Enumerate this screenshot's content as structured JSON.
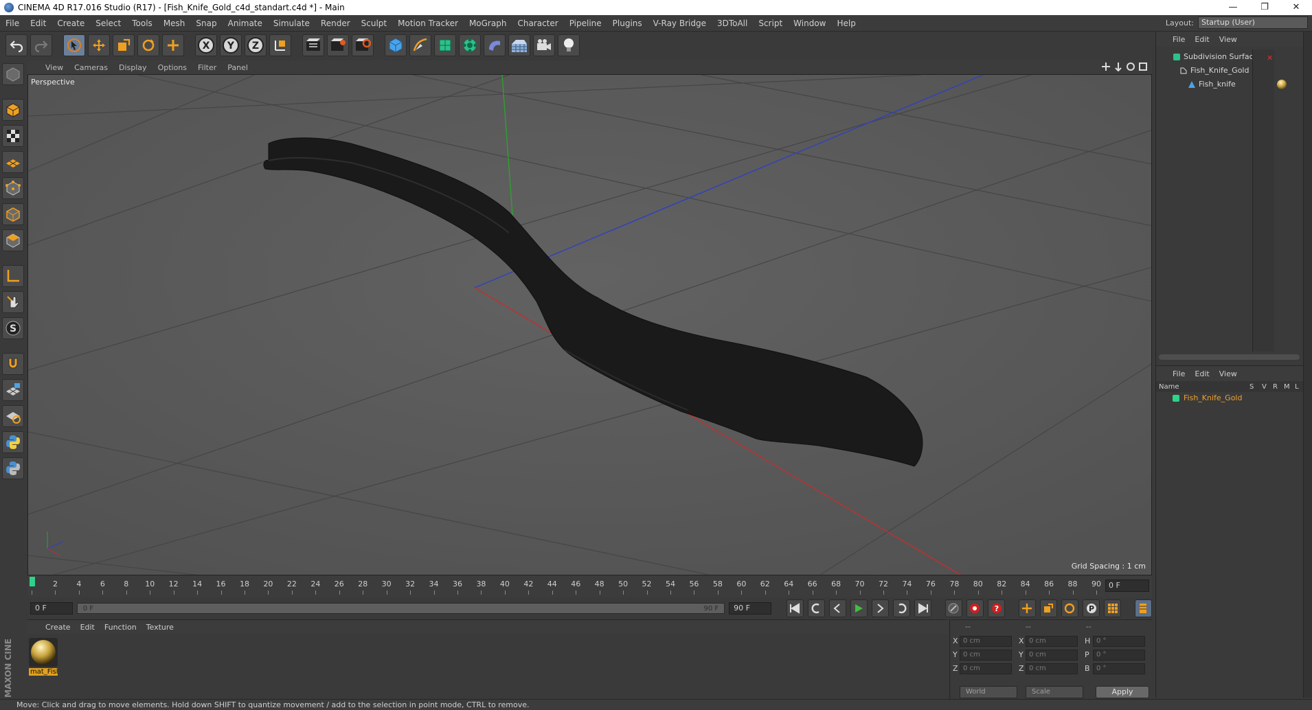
{
  "window": {
    "title": "CINEMA 4D R17.016 Studio (R17) - [Fish_Knife_Gold_c4d_standart.c4d *] - Main",
    "minimize": "—",
    "restore": "❐",
    "close": "✕"
  },
  "menubar": {
    "items": [
      "File",
      "Edit",
      "Create",
      "Select",
      "Tools",
      "Mesh",
      "Snap",
      "Animate",
      "Simulate",
      "Render",
      "Sculpt",
      "Motion Tracker",
      "MoGraph",
      "Character",
      "Pipeline",
      "Plugins",
      "V-Ray Bridge",
      "3DToAll",
      "Script",
      "Window",
      "Help"
    ],
    "layout_label": "Layout:",
    "layout_value": "Startup (User)"
  },
  "toolbar": {
    "icons": [
      "undo-icon",
      "redo-icon",
      "select-icon",
      "move-icon",
      "scale-icon",
      "rotate-icon",
      "transform-icon",
      "x-axis-icon",
      "y-axis-icon",
      "z-axis-icon",
      "world-coord-icon",
      "render-view-icon",
      "render-picture-queue-icon",
      "render-settings-icon",
      "cube-icon",
      "pen-icon",
      "subdivide-icon",
      "cloner-icon",
      "deformer-icon",
      "floor-icon",
      "camera-icon",
      "light-icon"
    ],
    "axis_labels": [
      "X",
      "Y",
      "Z"
    ]
  },
  "left_toolbar": {
    "icons": [
      "make-editable-icon",
      "model-mode-icon",
      "texture-mode-icon",
      "workplane-icon",
      "points-mode-icon",
      "edges-mode-icon",
      "polygons-mode-icon",
      "axis-mode-icon",
      "tweak-icon",
      "snap-icon",
      "magnet-icon",
      "lock-grid-icon",
      "deform-icon",
      "python-icon",
      "python-script-icon"
    ],
    "snap_letter": "S",
    "logo_text": "MAXON CINEMA 4D"
  },
  "viewport": {
    "menu": [
      "View",
      "Cameras",
      "Display",
      "Options",
      "Filter",
      "Panel"
    ],
    "camera": "Perspective",
    "grid_spacing": "Grid Spacing : 1 cm",
    "background": "#5b5b5b",
    "object_color": "#1a1a1a",
    "axis_colors": {
      "x": "#c03030",
      "y": "#30a030",
      "z": "#3040c0"
    }
  },
  "timeline": {
    "ticks": [
      0,
      2,
      4,
      6,
      8,
      10,
      12,
      14,
      16,
      18,
      20,
      22,
      24,
      26,
      28,
      30,
      32,
      34,
      36,
      38,
      40,
      42,
      44,
      46,
      48,
      50,
      52,
      54,
      56,
      58,
      60,
      62,
      64,
      66,
      68,
      70,
      72,
      74,
      76,
      78,
      80,
      82,
      84,
      86,
      88,
      90
    ],
    "current_frame": "0 F",
    "start_frame": "0 F",
    "range_start": "0 F",
    "range_end": "90 F",
    "end_frame": "90 F"
  },
  "transport": {
    "icons": [
      "goto-start-icon",
      "prev-key-icon",
      "step-back-icon",
      "play-icon",
      "step-forward-icon",
      "next-key-icon",
      "goto-end-icon",
      "record-icon",
      "autokey-icon",
      "keyframe-selection-icon",
      "move-key-icon",
      "scale-key-icon",
      "rotate-key-icon",
      "param-key-icon",
      "pla-key-icon",
      "timeline-icon"
    ]
  },
  "material_manager": {
    "menu": [
      "Create",
      "Edit",
      "Function",
      "Texture"
    ],
    "materials": [
      {
        "name": "mat_Fish"
      }
    ]
  },
  "coordinates": {
    "headers": [
      "--",
      "--",
      "--"
    ],
    "rows": [
      {
        "a": "X",
        "av": "0 cm",
        "b": "X",
        "bv": "0 cm",
        "c": "H",
        "cv": "0 °"
      },
      {
        "a": "Y",
        "av": "0 cm",
        "b": "Y",
        "bv": "0 cm",
        "c": "P",
        "cv": "0 °"
      },
      {
        "a": "Z",
        "av": "0 cm",
        "b": "Z",
        "bv": "0 cm",
        "c": "B",
        "cv": "0 °"
      }
    ],
    "mode": "World",
    "size_mode": "Scale",
    "apply": "Apply"
  },
  "object_manager": {
    "menu": [
      "File",
      "Edit",
      "View"
    ],
    "objects": [
      {
        "name": "Subdivision Surface",
        "depth": 0
      },
      {
        "name": "Fish_Knife_Gold",
        "depth": 1
      },
      {
        "name": "Fish_knife",
        "depth": 2
      }
    ]
  },
  "layer_manager": {
    "menu": [
      "File",
      "Edit",
      "View"
    ],
    "columns": {
      "name": "Name",
      "s": "S",
      "v": "V",
      "r": "R",
      "m": "M",
      "l": "L"
    },
    "layers": [
      {
        "name": "Fish_Knife_Gold",
        "color": "#2ed38a"
      }
    ]
  },
  "status": {
    "text": "Move: Click and drag to move elements. Hold down SHIFT to quantize movement / add to the selection in point mode, CTRL to remove."
  }
}
